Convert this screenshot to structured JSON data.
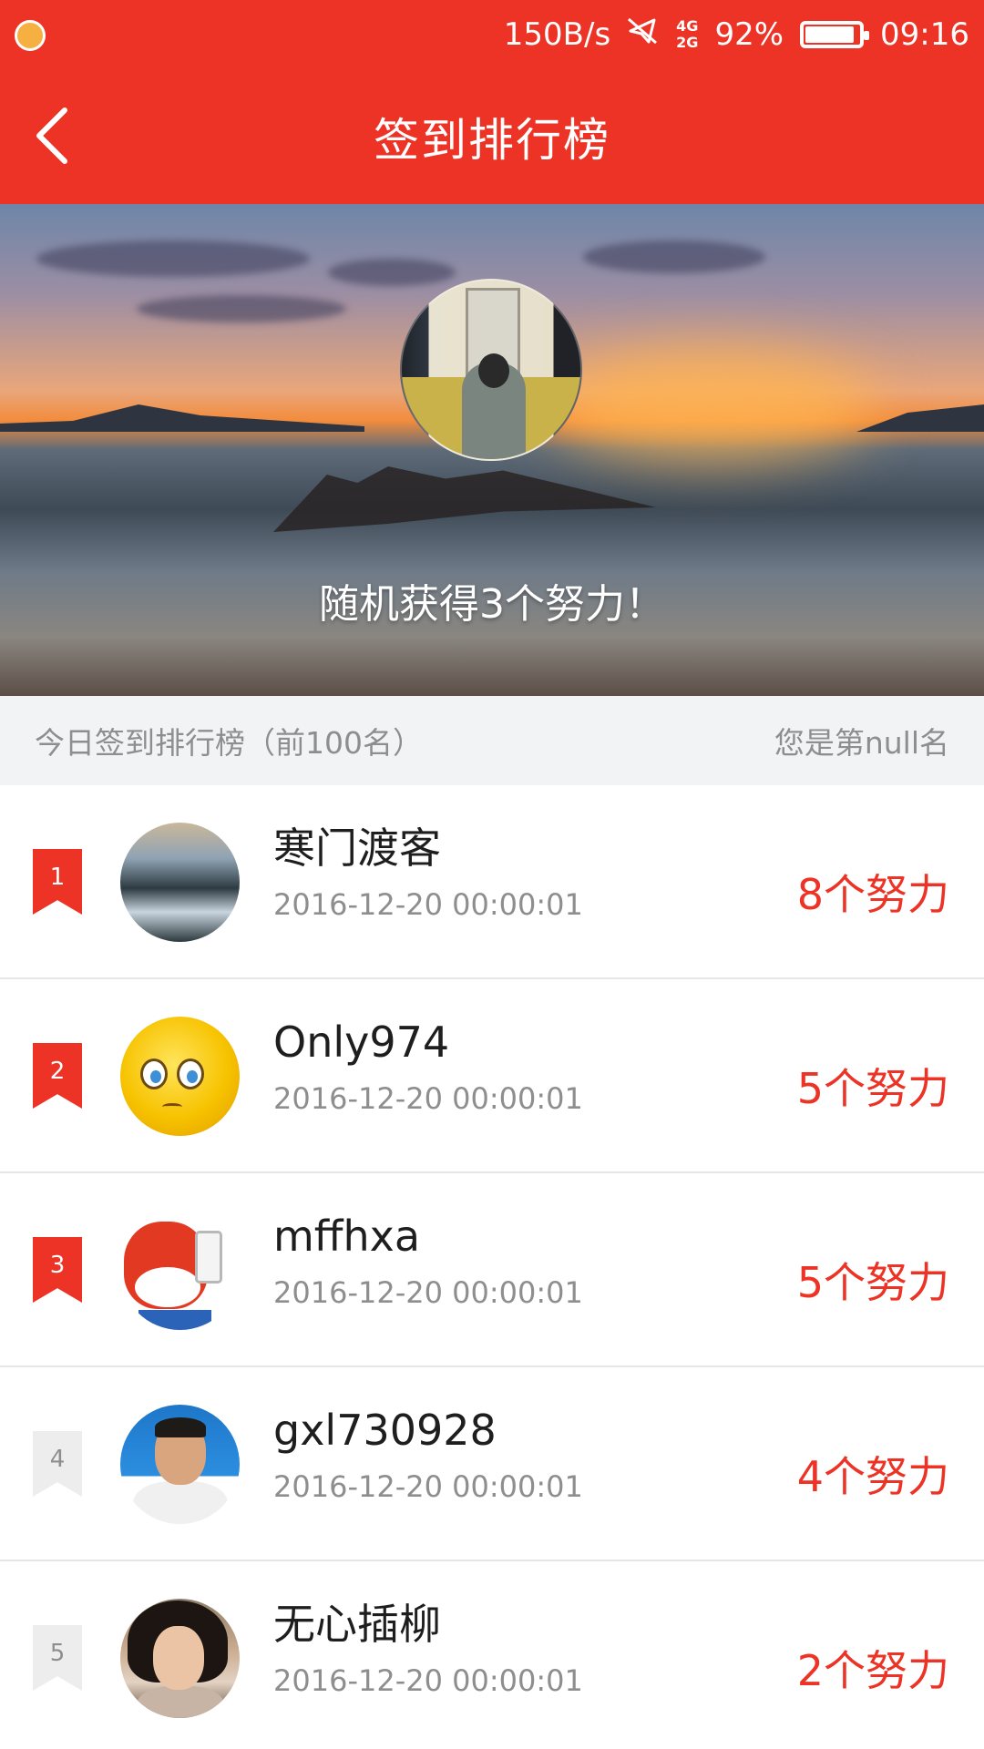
{
  "status_bar": {
    "speed": "150B/s",
    "network_top": "4G",
    "network_bottom": "2G",
    "battery": "92%",
    "time": "09:16"
  },
  "nav": {
    "title": "签到排行榜"
  },
  "hero": {
    "message": "随机获得3个努力！"
  },
  "rank_header": {
    "left": "今日签到排行榜（前100名）",
    "right": "您是第null名"
  },
  "rankings": [
    {
      "rank": "1",
      "name": "寒门渡客",
      "time": "2016-12-20 00:00:01",
      "score": "8个努力"
    },
    {
      "rank": "2",
      "name": "Only974",
      "time": "2016-12-20 00:00:01",
      "score": "5个努力"
    },
    {
      "rank": "3",
      "name": "mffhxa",
      "time": "2016-12-20 00:00:01",
      "score": "5个努力"
    },
    {
      "rank": "4",
      "name": "gxl730928",
      "time": "2016-12-20 00:00:01",
      "score": "4个努力"
    },
    {
      "rank": "5",
      "name": "无心插柳",
      "time": "2016-12-20 00:00:01",
      "score": "2个努力"
    }
  ],
  "colors": {
    "primary": "#EC3325",
    "header_bg": "#F2F3F5",
    "muted_text": "#8E8E8E"
  },
  "icons": {
    "back": "chevron-left-icon",
    "mute": "mute-icon",
    "battery": "battery-icon"
  }
}
